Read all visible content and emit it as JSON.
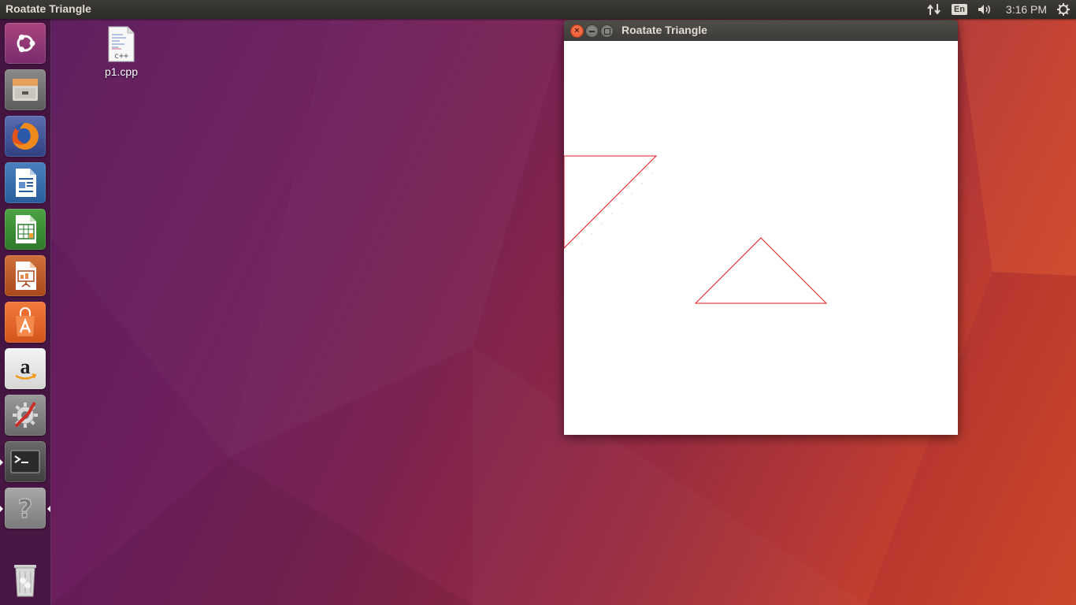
{
  "top_panel": {
    "active_app_title": "Roatate Triangle",
    "keyboard_layout": "En",
    "clock": "3:16 PM"
  },
  "launcher": {
    "items": [
      {
        "name": "ubuntu-dash",
        "icon": "ubuntu-logo-icon"
      },
      {
        "name": "files",
        "icon": "file-cabinet-icon"
      },
      {
        "name": "firefox",
        "icon": "firefox-icon"
      },
      {
        "name": "libreoffice-writer",
        "icon": "writer-document-icon"
      },
      {
        "name": "libreoffice-calc",
        "icon": "calc-spreadsheet-icon"
      },
      {
        "name": "libreoffice-impress",
        "icon": "impress-presentation-icon"
      },
      {
        "name": "ubuntu-software",
        "icon": "shopping-bag-icon"
      },
      {
        "name": "amazon",
        "icon": "amazon-icon"
      },
      {
        "name": "system-settings",
        "icon": "settings-wrench-icon"
      },
      {
        "name": "terminal",
        "icon": "terminal-icon"
      },
      {
        "name": "help",
        "icon": "question-mark-icon"
      },
      {
        "name": "trash",
        "icon": "trash-icon"
      }
    ]
  },
  "desktop": {
    "file_icon_badge": "c++",
    "file_label": "p1.cpp"
  },
  "window": {
    "title": "Roatate Triangle",
    "canvas_background": "#ffffff",
    "stroke_color": "#e0191e"
  },
  "colors": {
    "panel": "#3c3b37",
    "close_button": "#e9542f",
    "panel_text": "#dfdbd2"
  }
}
